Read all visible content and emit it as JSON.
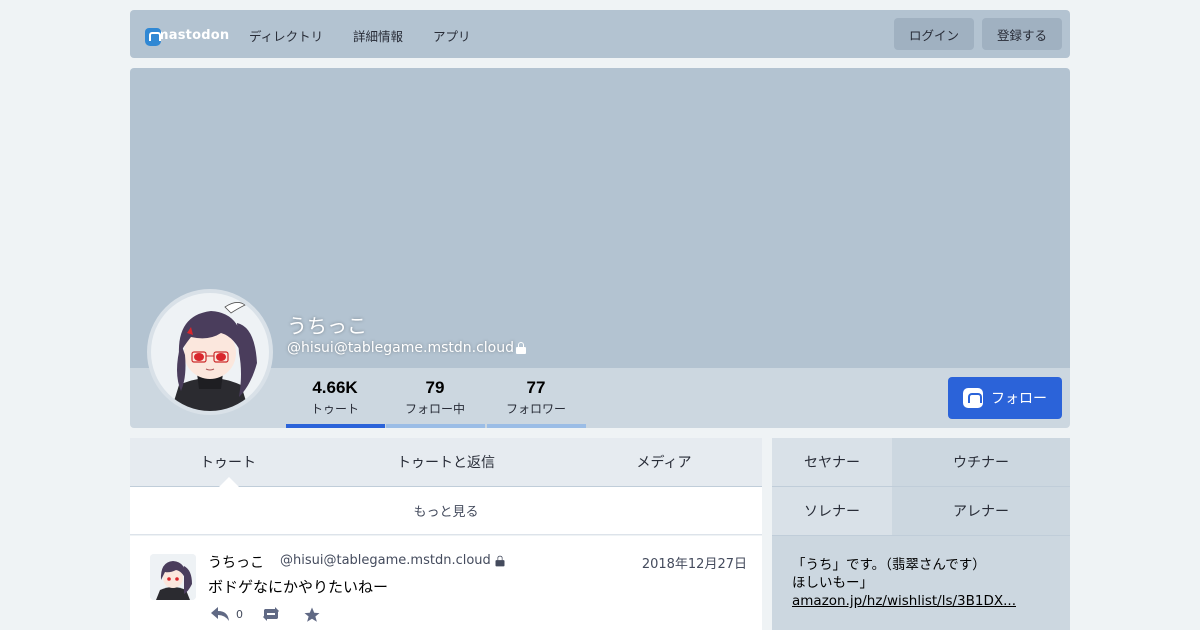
{
  "colors": {
    "page_bg": "#eff3f5",
    "topbar_bg": "#b3c3d1",
    "header_bg": "#b3c3d1",
    "stats_bg": "#ccd7e0",
    "accent": "#2b63d9",
    "active_counter_line": "#2b63d9",
    "inactive_counter_line": "#9bbde6"
  },
  "topbar": {
    "logo_text": "mastodon",
    "nav": [
      "ディレクトリ",
      "詳細情報",
      "アプリ"
    ],
    "login_label": "ログイン",
    "signup_label": "登録する"
  },
  "profile": {
    "display_name": "うちっこ",
    "acct": "@hisui@tablegame.mstdn.cloud",
    "locked_icon": "lock-icon",
    "follow_label": "フォロー",
    "counters": [
      {
        "value": "4.66K",
        "label": "トゥート",
        "active": true
      },
      {
        "value": "79",
        "label": "フォロー中",
        "active": false
      },
      {
        "value": "77",
        "label": "フォロワー",
        "active": false
      }
    ]
  },
  "timeline": {
    "tabs": [
      "トゥート",
      "トゥートと返信",
      "メディア"
    ],
    "active_tab": "トゥート",
    "load_more_label": "もっと見る",
    "statuses": [
      {
        "display_name": "うちっこ",
        "acct": "@hisui@tablegame.mstdn.cloud",
        "date": "2018年12月27日",
        "text": "ボドゲなにかやりたいねー",
        "reply_count": "0"
      }
    ]
  },
  "sidebar": {
    "fields": [
      {
        "name": "セヤナー",
        "value": "ウチナー"
      },
      {
        "name": "ソレナー",
        "value": "アレナー"
      }
    ],
    "bio_lines": [
      "「うち」です。（翡翠さんです）",
      "ほしいもー」"
    ],
    "bio_link": "amazon.jp/hz/wishlist/ls/3B1DX..."
  }
}
